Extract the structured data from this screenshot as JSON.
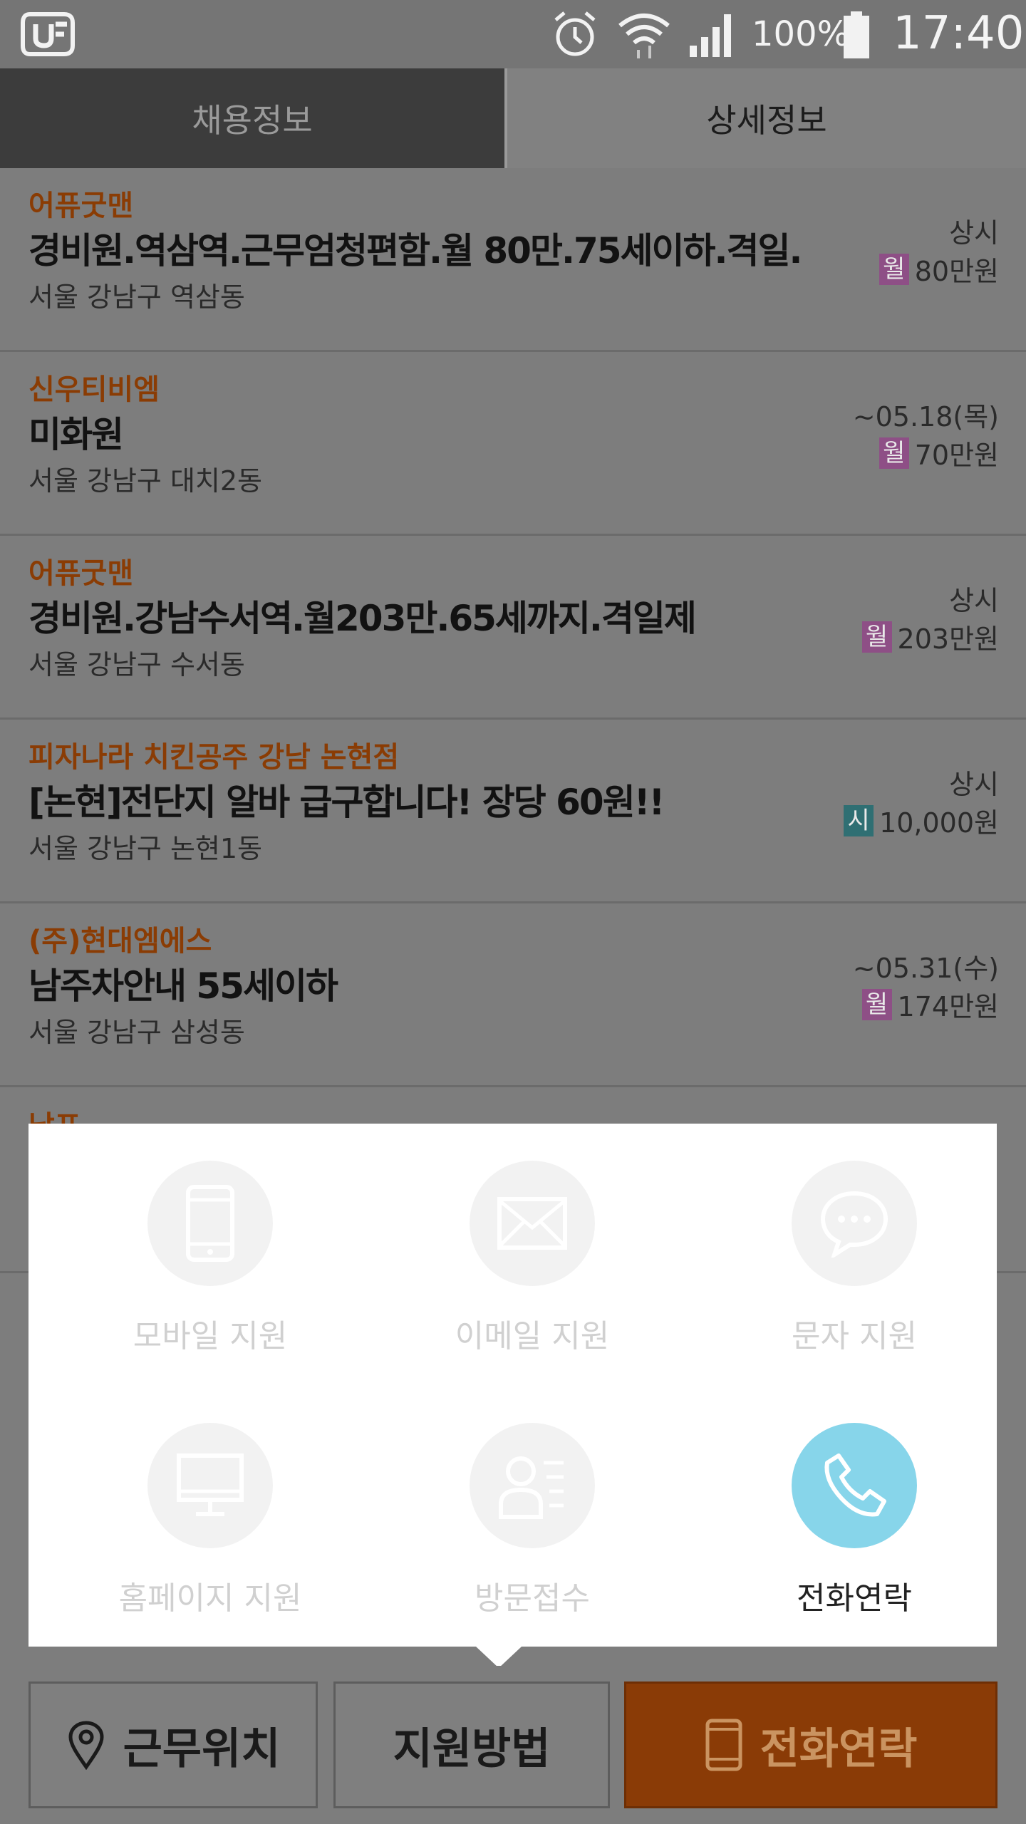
{
  "status_bar": {
    "battery_percent": "100%",
    "time": "17:40",
    "icons": [
      "app-logo-icon",
      "alarm-icon",
      "wifi-icon",
      "signal-icon",
      "battery-icon"
    ]
  },
  "tabs": [
    {
      "label": "채용정보",
      "selected": false
    },
    {
      "label": "상세정보",
      "selected": true
    }
  ],
  "jobs": [
    {
      "company": "어퓨굿맨",
      "title": "경비원.역삼역.근무엄청편함.월 80만.75세이하.격일.",
      "location": "서울 강남구 역삼동",
      "date": "상시",
      "pay_type": "월",
      "pay": "80만원"
    },
    {
      "company": "신우티비엠",
      "title": "미화원",
      "location": "서울 강남구 대치2동",
      "date": "~05.18(목)",
      "pay_type": "월",
      "pay": "70만원"
    },
    {
      "company": "어퓨굿맨",
      "title": "경비원.강남수서역.월203만.65세까지.격일제",
      "location": "서울 강남구 수서동",
      "date": "상시",
      "pay_type": "월",
      "pay": "203만원"
    },
    {
      "company": "피자나라 치킨공주 강남 논현점",
      "title": "[논현]전단지 알바 급구합니다! 장당 60원!!",
      "location": "서울 강남구 논현1동",
      "date": "상시",
      "pay_type": "시",
      "pay": "10,000원"
    },
    {
      "company": "(주)현대엠에스",
      "title": "남주차안내 55세이하",
      "location": "서울 강남구 삼성동",
      "date": "~05.31(수)",
      "pay_type": "월",
      "pay": "174만원"
    }
  ],
  "partial_job": {
    "company": "남프"
  },
  "colors": {
    "monthly_badge": "#8e4f86",
    "hourly_badge": "#2f6f73",
    "company": "#8a3c04",
    "call_accent": "#87d5ea",
    "call_button": "#8a3b06"
  },
  "apply_options": [
    {
      "label": "모바일 지원",
      "icon": "mobile-phone-icon",
      "enabled": false
    },
    {
      "label": "이메일 지원",
      "icon": "envelope-icon",
      "enabled": false
    },
    {
      "label": "문자 지원",
      "icon": "chat-bubble-icon",
      "enabled": false
    },
    {
      "label": "홈페이지 지원",
      "icon": "monitor-icon",
      "enabled": false
    },
    {
      "label": "방문접수",
      "icon": "visitor-card-icon",
      "enabled": false
    },
    {
      "label": "전화연락",
      "icon": "phone-handset-icon",
      "enabled": true
    }
  ],
  "bottom_bar": {
    "location_label": "근무위치",
    "method_label": "지원방법",
    "call_label": "전화연락"
  }
}
